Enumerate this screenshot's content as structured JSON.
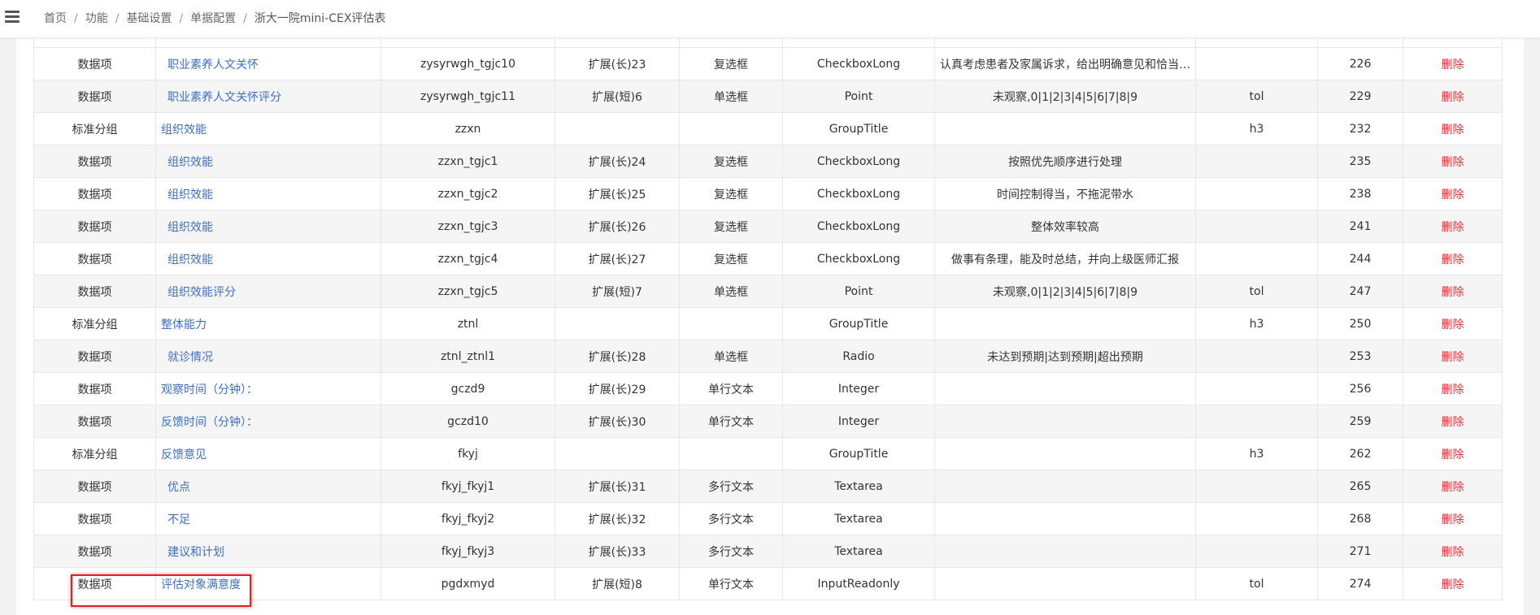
{
  "breadcrumb": [
    "首页",
    "功能",
    "基础设置",
    "单据配置",
    "浙大一院mini-CEX评估表"
  ],
  "rows": [
    {
      "type": "数据项",
      "name": "职业素养人文关怀",
      "indent": true,
      "code": "zysyrwgh_tgjc10",
      "ext": "扩展(长)23",
      "ctrl": "复选框",
      "ctype": "CheckboxLong",
      "options": "认真考虑患者及家属诉求，给出明确意见和恰当…",
      "extra": "",
      "num": "226",
      "del": "删除"
    },
    {
      "type": "数据项",
      "name": "职业素养人文关怀评分",
      "indent": true,
      "code": "zysyrwgh_tgjc11",
      "ext": "扩展(短)6",
      "ctrl": "单选框",
      "ctype": "Point",
      "options": "未观察,0|1|2|3|4|5|6|7|8|9",
      "extra": "tol",
      "num": "229",
      "del": "删除"
    },
    {
      "type": "标准分组",
      "name": "组织效能",
      "indent": false,
      "code": "zzxn",
      "ext": "",
      "ctrl": "",
      "ctype": "GroupTitle",
      "options": "",
      "extra": "h3",
      "num": "232",
      "del": "删除"
    },
    {
      "type": "数据项",
      "name": "组织效能",
      "indent": true,
      "code": "zzxn_tgjc1",
      "ext": "扩展(长)24",
      "ctrl": "复选框",
      "ctype": "CheckboxLong",
      "options": "按照优先顺序进行处理",
      "extra": "",
      "num": "235",
      "del": "删除"
    },
    {
      "type": "数据项",
      "name": "组织效能",
      "indent": true,
      "code": "zzxn_tgjc2",
      "ext": "扩展(长)25",
      "ctrl": "复选框",
      "ctype": "CheckboxLong",
      "options": "时间控制得当，不拖泥带水",
      "extra": "",
      "num": "238",
      "del": "删除"
    },
    {
      "type": "数据项",
      "name": "组织效能",
      "indent": true,
      "code": "zzxn_tgjc3",
      "ext": "扩展(长)26",
      "ctrl": "复选框",
      "ctype": "CheckboxLong",
      "options": "整体效率较高",
      "extra": "",
      "num": "241",
      "del": "删除"
    },
    {
      "type": "数据项",
      "name": "组织效能",
      "indent": true,
      "code": "zzxn_tgjc4",
      "ext": "扩展(长)27",
      "ctrl": "复选框",
      "ctype": "CheckboxLong",
      "options": "做事有条理，能及时总结，并向上级医师汇报",
      "extra": "",
      "num": "244",
      "del": "删除"
    },
    {
      "type": "数据项",
      "name": "组织效能评分",
      "indent": true,
      "code": "zzxn_tgjc5",
      "ext": "扩展(短)7",
      "ctrl": "单选框",
      "ctype": "Point",
      "options": "未观察,0|1|2|3|4|5|6|7|8|9",
      "extra": "tol",
      "num": "247",
      "del": "删除"
    },
    {
      "type": "标准分组",
      "name": "整体能力",
      "indent": false,
      "code": "ztnl",
      "ext": "",
      "ctrl": "",
      "ctype": "GroupTitle",
      "options": "",
      "extra": "h3",
      "num": "250",
      "del": "删除"
    },
    {
      "type": "数据项",
      "name": "就诊情况",
      "indent": true,
      "code": "ztnl_ztnl1",
      "ext": "扩展(长)28",
      "ctrl": "单选框",
      "ctype": "Radio",
      "options": "未达到预期|达到预期|超出预期",
      "extra": "",
      "num": "253",
      "del": "删除"
    },
    {
      "type": "数据项",
      "name": "观察时间（分钟）：",
      "indent": false,
      "code": "gczd9",
      "ext": "扩展(长)29",
      "ctrl": "单行文本",
      "ctype": "Integer",
      "options": "",
      "extra": "",
      "num": "256",
      "del": "删除"
    },
    {
      "type": "数据项",
      "name": "反馈时间（分钟）：",
      "indent": false,
      "code": "gczd10",
      "ext": "扩展(长)30",
      "ctrl": "单行文本",
      "ctype": "Integer",
      "options": "",
      "extra": "",
      "num": "259",
      "del": "删除"
    },
    {
      "type": "标准分组",
      "name": "反馈意见",
      "indent": false,
      "code": "fkyj",
      "ext": "",
      "ctrl": "",
      "ctype": "GroupTitle",
      "options": "",
      "extra": "h3",
      "num": "262",
      "del": "删除"
    },
    {
      "type": "数据项",
      "name": "优点",
      "indent": true,
      "code": "fkyj_fkyj1",
      "ext": "扩展(长)31",
      "ctrl": "多行文本",
      "ctype": "Textarea",
      "options": "",
      "extra": "",
      "num": "265",
      "del": "删除"
    },
    {
      "type": "数据项",
      "name": "不足",
      "indent": true,
      "code": "fkyj_fkyj2",
      "ext": "扩展(长)32",
      "ctrl": "多行文本",
      "ctype": "Textarea",
      "options": "",
      "extra": "",
      "num": "268",
      "del": "删除"
    },
    {
      "type": "数据项",
      "name": "建议和计划",
      "indent": true,
      "code": "fkyj_fkyj3",
      "ext": "扩展(长)33",
      "ctrl": "多行文本",
      "ctype": "Textarea",
      "options": "",
      "extra": "",
      "num": "271",
      "del": "删除"
    },
    {
      "type": "数据项",
      "name": "评估对象满意度",
      "indent": false,
      "code": "pgdxmyd",
      "ext": "扩展(短)8",
      "ctrl": "单行文本",
      "ctype": "InputReadonly",
      "options": "",
      "extra": "tol",
      "num": "274",
      "del": "删除"
    }
  ]
}
